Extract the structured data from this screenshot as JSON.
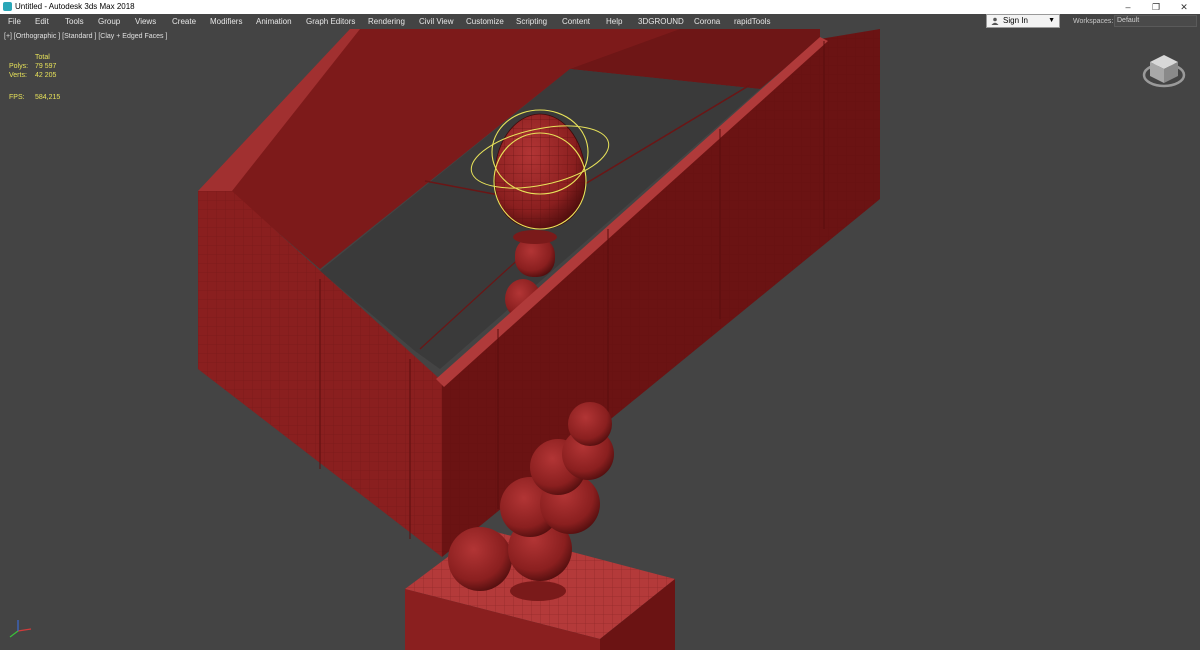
{
  "window": {
    "title": "Untitled - Autodesk 3ds Max 2018",
    "buttons": {
      "minimize": "–",
      "restore": "❐",
      "close": "✕"
    }
  },
  "menu": [
    "File",
    "Edit",
    "Tools",
    "Group",
    "Views",
    "Create",
    "Modifiers",
    "Animation",
    "Graph Editors",
    "Rendering",
    "Civil View",
    "Customize",
    "Scripting",
    "Content",
    "Help",
    "3DGROUND",
    "Corona",
    "rapidTools"
  ],
  "signin": {
    "label": "Sign In"
  },
  "workspace": {
    "label": "Workspaces:",
    "value": "Default"
  },
  "viewport": {
    "label": "[+] [Orthographic ] [Standard ] [Clay + Edged Faces ]",
    "stats": {
      "header": "Total",
      "polys_label": "Polys:",
      "polys_value": "79 597",
      "verts_label": "Verts:",
      "verts_value": "42 205",
      "fps_label": "FPS:",
      "fps_value": "584,215"
    }
  },
  "colors": {
    "viewport_bg": "#444444",
    "clay": "#8a1f1f",
    "selection": "#e8e35a",
    "stats_text": "#e8e35a"
  },
  "icons": [
    "app-icon",
    "user-icon",
    "viewcube-icon",
    "axis-tripod-icon"
  ]
}
